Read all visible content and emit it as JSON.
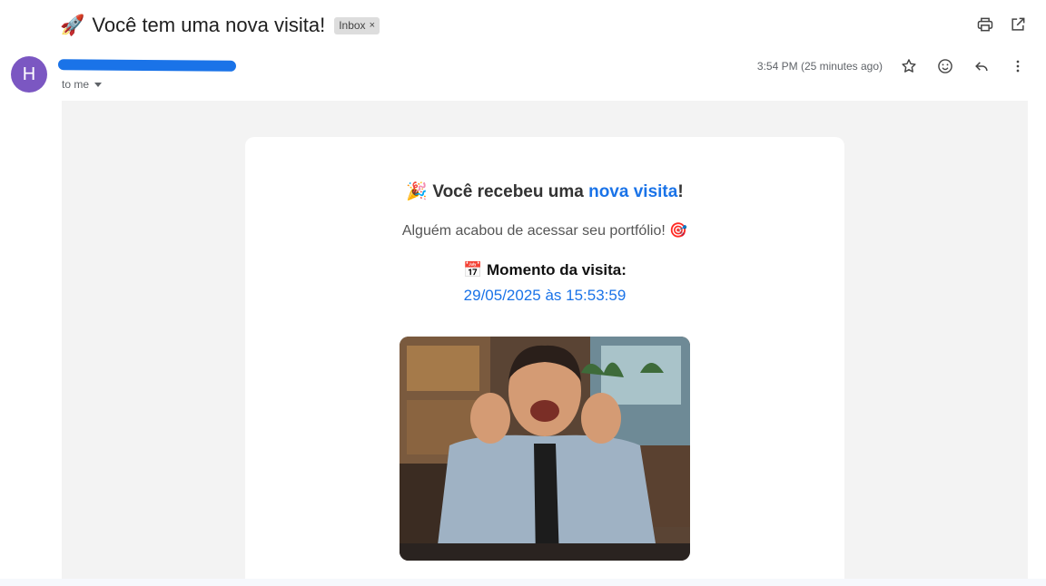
{
  "subject": {
    "emoji": "🚀",
    "text": "Você tem uma nova visita!",
    "label": "Inbox",
    "label_close": "×"
  },
  "sender": {
    "avatar_letter": "H",
    "to": "to me"
  },
  "meta": {
    "time": "3:54 PM (25 minutes ago)"
  },
  "icons": {
    "print": "print-icon",
    "open_new": "open-in-new-icon",
    "star": "star-icon",
    "emoji": "emoji-icon",
    "reply": "reply-icon",
    "more": "more-vert-icon"
  },
  "email": {
    "headline_emoji": "🎉",
    "headline_prefix": "Você recebeu uma ",
    "headline_accent": "nova visita",
    "headline_suffix": "!",
    "sub": "Alguém acabou de acessar seu portfólio! 🎯",
    "moment_label": "📅 Momento da visita:",
    "moment_value": "29/05/2025 às 15:53:59"
  },
  "colors": {
    "accent": "#1a73e8",
    "avatar": "#7b57c2",
    "background": "#f3f3f3"
  }
}
